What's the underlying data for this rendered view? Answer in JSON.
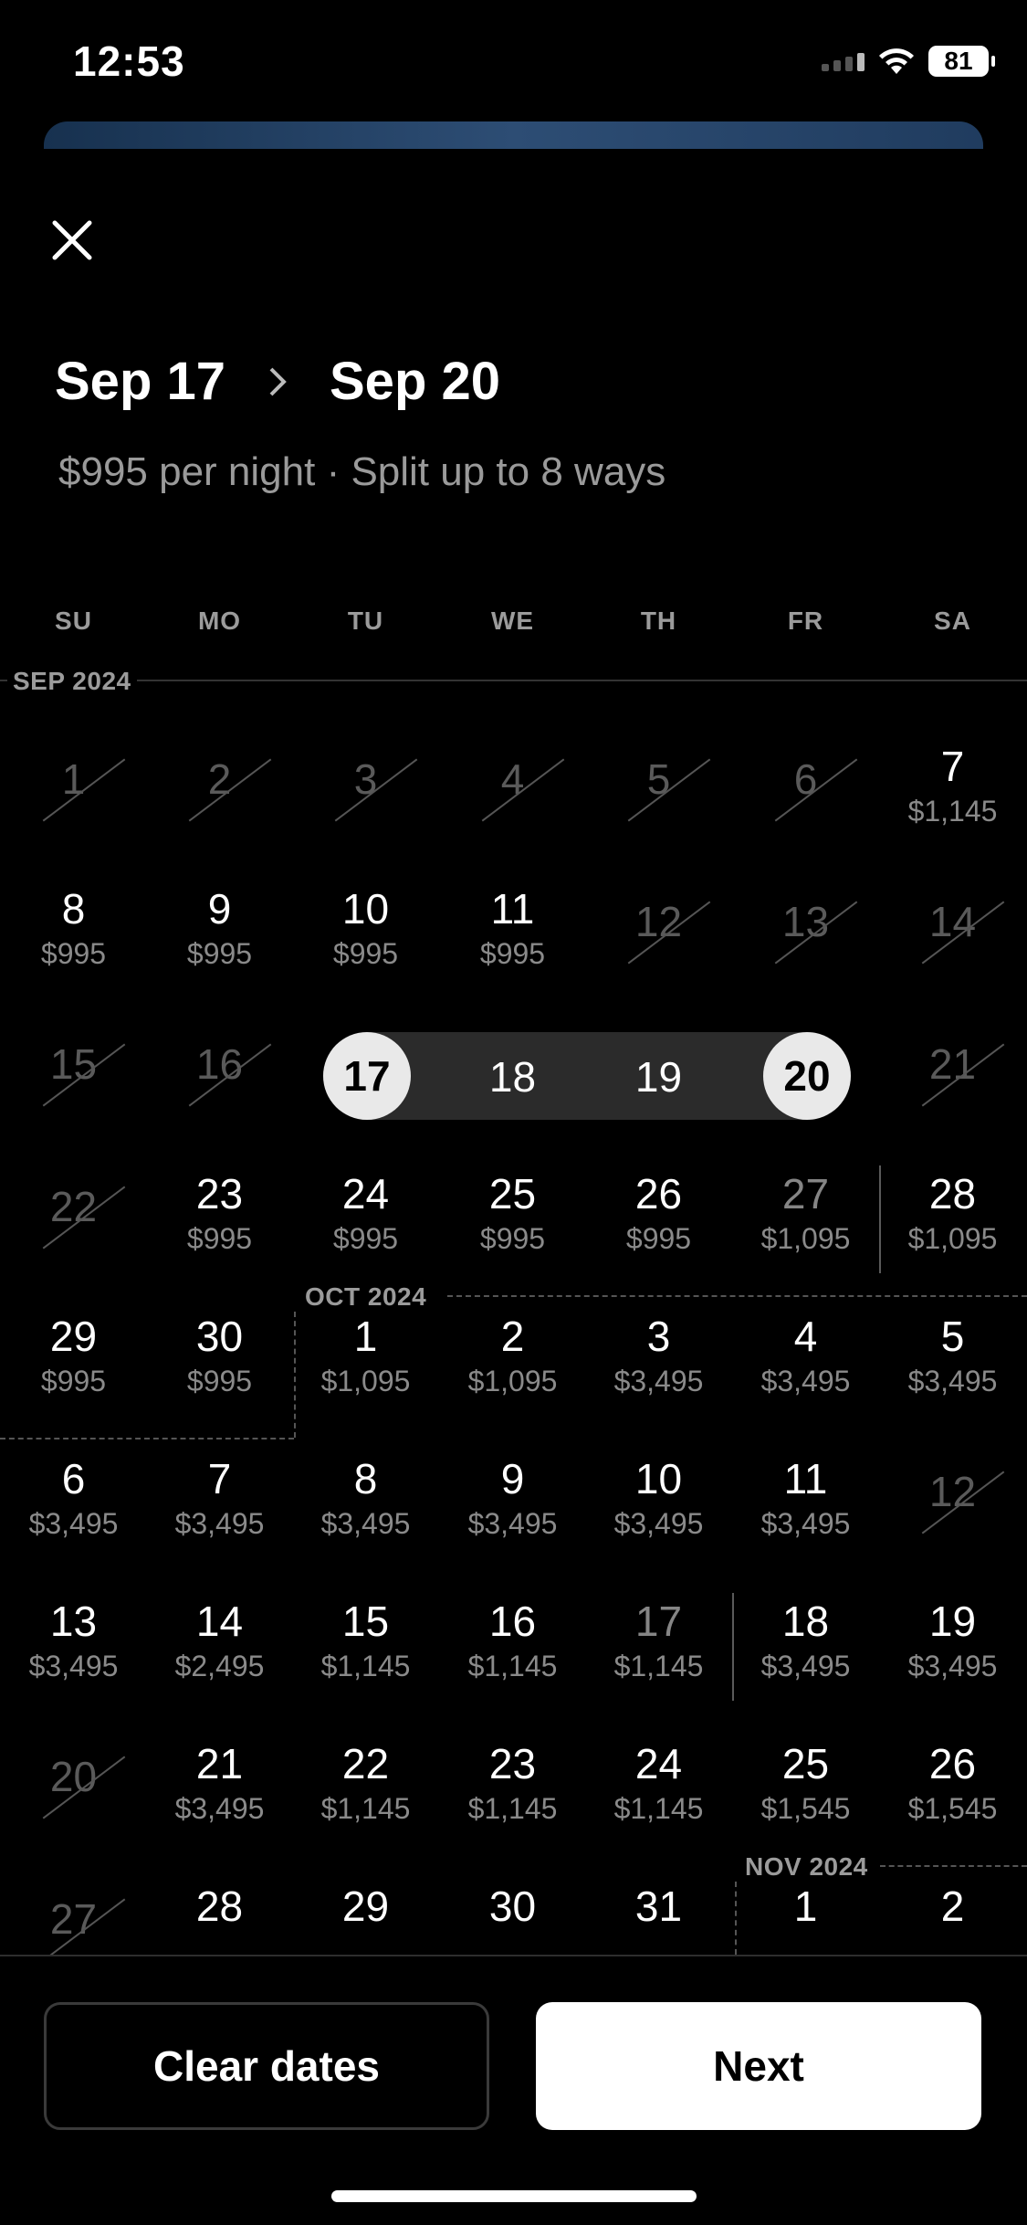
{
  "status_bar": {
    "time": "12:53",
    "battery": "81"
  },
  "header": {
    "start_date": "Sep 17",
    "end_date": "Sep 20",
    "subtitle": "$995 per night · Split up to 8 ways"
  },
  "weekdays": [
    "SU",
    "MO",
    "TU",
    "WE",
    "TH",
    "FR",
    "SA"
  ],
  "months": {
    "sep": "SEP 2024",
    "oct": "OCT 2024",
    "nov": "NOV 2024"
  },
  "selection": {
    "start": "17",
    "mid1": "18",
    "mid2": "19",
    "end": "20"
  },
  "weeks": [
    [
      {
        "d": "1",
        "s": "blocked"
      },
      {
        "d": "2",
        "s": "blocked"
      },
      {
        "d": "3",
        "s": "blocked"
      },
      {
        "d": "4",
        "s": "blocked"
      },
      {
        "d": "5",
        "s": "blocked"
      },
      {
        "d": "6",
        "s": "blocked"
      },
      {
        "d": "7",
        "p": "$1,145"
      }
    ],
    [
      {
        "d": "8",
        "p": "$995"
      },
      {
        "d": "9",
        "p": "$995"
      },
      {
        "d": "10",
        "p": "$995"
      },
      {
        "d": "11",
        "p": "$995"
      },
      {
        "d": "12",
        "s": "blocked"
      },
      {
        "d": "13",
        "s": "blocked"
      },
      {
        "d": "14",
        "s": "blocked"
      }
    ],
    [
      {
        "d": "15",
        "s": "blocked"
      },
      {
        "d": "16",
        "s": "blocked"
      },
      {
        "d": "",
        "s": "selected"
      },
      {
        "d": "",
        "s": "selected"
      },
      {
        "d": "",
        "s": "selected"
      },
      {
        "d": "",
        "s": "selected"
      },
      {
        "d": "21",
        "s": "blocked"
      }
    ],
    [
      {
        "d": "22",
        "s": "blocked"
      },
      {
        "d": "23",
        "p": "$995"
      },
      {
        "d": "24",
        "p": "$995"
      },
      {
        "d": "25",
        "p": "$995"
      },
      {
        "d": "26",
        "p": "$995"
      },
      {
        "d": "27",
        "p": "$1,095",
        "s": "muted"
      },
      {
        "d": "28",
        "p": "$1,095"
      }
    ],
    [
      {
        "d": "29",
        "p": "$995"
      },
      {
        "d": "30",
        "p": "$995"
      },
      {
        "d": "1",
        "p": "$1,095"
      },
      {
        "d": "2",
        "p": "$1,095"
      },
      {
        "d": "3",
        "p": "$3,495"
      },
      {
        "d": "4",
        "p": "$3,495"
      },
      {
        "d": "5",
        "p": "$3,495"
      }
    ],
    [
      {
        "d": "6",
        "p": "$3,495"
      },
      {
        "d": "7",
        "p": "$3,495"
      },
      {
        "d": "8",
        "p": "$3,495"
      },
      {
        "d": "9",
        "p": "$3,495"
      },
      {
        "d": "10",
        "p": "$3,495"
      },
      {
        "d": "11",
        "p": "$3,495"
      },
      {
        "d": "12",
        "s": "blocked"
      }
    ],
    [
      {
        "d": "13",
        "p": "$3,495"
      },
      {
        "d": "14",
        "p": "$2,495"
      },
      {
        "d": "15",
        "p": "$1,145"
      },
      {
        "d": "16",
        "p": "$1,145"
      },
      {
        "d": "17",
        "p": "$1,145",
        "s": "muted"
      },
      {
        "d": "18",
        "p": "$3,495"
      },
      {
        "d": "19",
        "p": "$3,495"
      }
    ],
    [
      {
        "d": "20",
        "s": "blocked"
      },
      {
        "d": "21",
        "p": "$3,495"
      },
      {
        "d": "22",
        "p": "$1,145"
      },
      {
        "d": "23",
        "p": "$1,145"
      },
      {
        "d": "24",
        "p": "$1,145"
      },
      {
        "d": "25",
        "p": "$1,545"
      },
      {
        "d": "26",
        "p": "$1,545"
      }
    ],
    [
      {
        "d": "27",
        "s": "blocked"
      },
      {
        "d": "28",
        "p": ""
      },
      {
        "d": "29",
        "p": ""
      },
      {
        "d": "30",
        "p": ""
      },
      {
        "d": "31",
        "p": ""
      },
      {
        "d": "1",
        "p": ""
      },
      {
        "d": "2",
        "p": ""
      }
    ]
  ],
  "footer": {
    "clear_label": "Clear dates",
    "next_label": "Next"
  }
}
